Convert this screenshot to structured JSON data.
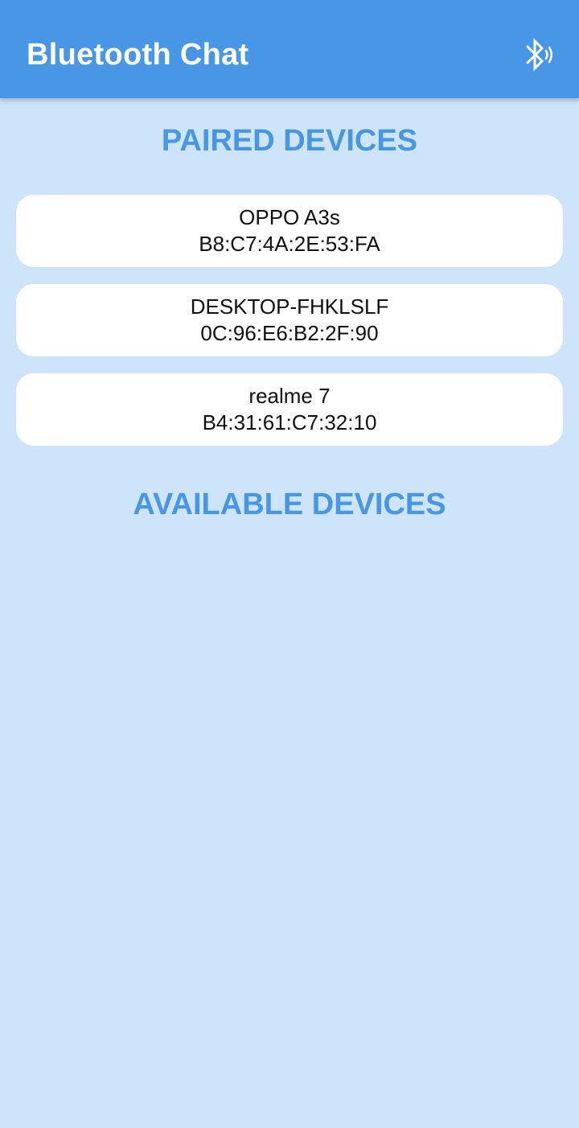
{
  "app_bar": {
    "title": "Bluetooth Chat",
    "bluetooth_icon": "bluetooth-searching-icon"
  },
  "paired_section": {
    "heading": "PAIRED DEVICES",
    "devices": [
      {
        "name": "OPPO A3s",
        "address": "B8:C7:4A:2E:53:FA"
      },
      {
        "name": "DESKTOP-FHKLSLF",
        "address": "0C:96:E6:B2:2F:90"
      },
      {
        "name": "realme 7",
        "address": "B4:31:61:C7:32:10"
      }
    ]
  },
  "available_section": {
    "heading": "AVAILABLE DEVICES",
    "devices": []
  },
  "colors": {
    "primary": "#4797e6",
    "background": "#cde4fa",
    "card": "#ffffff",
    "text": "#111111"
  }
}
